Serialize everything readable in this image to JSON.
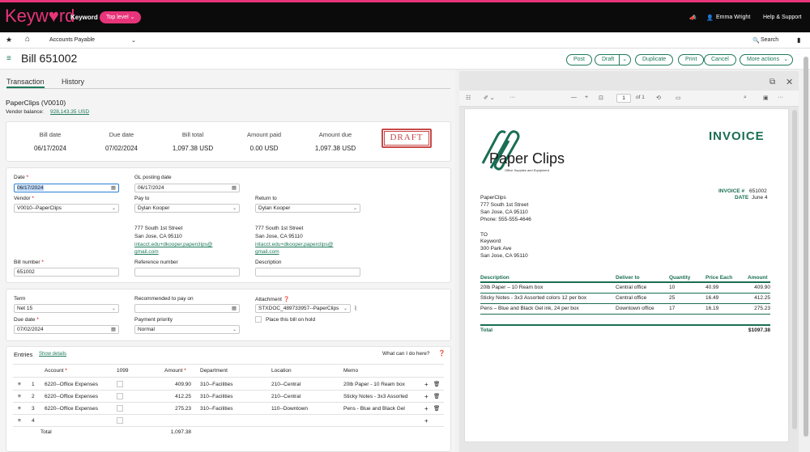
{
  "app": {
    "logo": "Keyw♥rd",
    "logo_sub": "Keyword",
    "top_level": "Top level",
    "user_name": "Emma Wright",
    "help": "Help & Support"
  },
  "nav": {
    "module": "Accounts Payable",
    "search": "Search"
  },
  "titlebar": {
    "title": "Bill 651002",
    "post": "Post",
    "draft": "Draft",
    "duplicate": "Duplicate",
    "print": "Print",
    "cancel": "Cancel",
    "more": "More actions"
  },
  "tabs": {
    "transaction": "Transaction",
    "history": "History"
  },
  "vendor": {
    "name": "PaperClips (V0010)",
    "balance_label": "Vendor balance:",
    "balance": "928,143.35 USD"
  },
  "summary": {
    "bill_date_label": "Bill date",
    "bill_date": "06/17/2024",
    "due_date_label": "Due date",
    "due_date": "07/02/2024",
    "bill_total_label": "Bill total",
    "bill_total": "1,097.38 USD",
    "amount_paid_label": "Amount paid",
    "amount_paid": "0.00 USD",
    "amount_due_label": "Amount due",
    "amount_due": "1,097.38 USD",
    "stamp": "DRAFT"
  },
  "form": {
    "date_label": "Date",
    "date": "06/17/2024",
    "gl_label": "GL posting date",
    "gl": "06/17/2024",
    "vendor_label": "Vendor",
    "vendor": "V0010--PaperClips",
    "payto_label": "Pay to",
    "payto": "Dylan Kooper",
    "returnto_label": "Return to",
    "returnto": "Dylan Kooper",
    "addr1": "777 South 1st Street",
    "addr2": "San Jose, CA 95110",
    "email1": "intacct.edu+dkooper.paperclips@",
    "email2": "gmail.com",
    "billno_label": "Bill number",
    "billno": "651002",
    "ref_label": "Reference number",
    "ref": "",
    "desc_label": "Description",
    "desc": "",
    "term_label": "Term",
    "term": "Net 15",
    "recpay_label": "Recommended to pay on",
    "recpay": "",
    "attach_label": "Attachment",
    "attach": "STXDOC_489733957--PaperClips",
    "due_label": "Due date",
    "due": "07/02/2024",
    "priority_label": "Payment priority",
    "priority": "Normal",
    "hold_label": "Place this bill on hold"
  },
  "entries": {
    "title": "Entries",
    "show_defaults": "Show details",
    "help": "What can I do here?",
    "headers": {
      "account": "Account",
      "c1099": "1099",
      "amount": "Amount",
      "department": "Department",
      "location": "Location",
      "memo": "Memo"
    },
    "rows": [
      {
        "n": "1",
        "account": "6220--Office Expenses",
        "amount": "409.90",
        "department": "310--Facilities",
        "location": "210--Central",
        "memo": "20lb Paper - 10 Ream box"
      },
      {
        "n": "2",
        "account": "6220--Office Expenses",
        "amount": "412.25",
        "department": "310--Facilities",
        "location": "210--Central",
        "memo": "Sticky Notes - 3x3 Assorted"
      },
      {
        "n": "3",
        "account": "6220--Office Expenses",
        "amount": "275.23",
        "department": "310--Facilities",
        "location": "110--Downtown",
        "memo": "Pens - Blue and Black Gel"
      },
      {
        "n": "4",
        "account": "",
        "amount": "",
        "department": "",
        "location": "",
        "memo": ""
      }
    ],
    "total_label": "Total",
    "total": "1,097.38"
  },
  "pdf": {
    "page": "1",
    "of": "of 1",
    "zoom_minus": "—",
    "zoom_plus": "+"
  },
  "invoice": {
    "brand": "Paper Clips",
    "brand_sub": "Office Supplies and Equipment",
    "heading": "INVOICE",
    "invoice_no_label": "INVOICE #",
    "invoice_no": "651002",
    "date_label": "DATE",
    "date": "June 4",
    "from": [
      "PaperClips",
      "777 South 1st Street",
      "San Jose, CA 95110",
      "Phone: 555-555-4646"
    ],
    "to_label": "TO",
    "to": [
      "Keyword",
      "300 Park Ave",
      "San Jose, CA 95110"
    ],
    "headers": {
      "description": "Description",
      "deliver": "Deliver to",
      "quantity": "Quantity",
      "price": "Price Each",
      "amount": "Amount"
    },
    "lines": [
      {
        "description": "20lb Paper – 10 Ream box",
        "deliver": "Central office",
        "quantity": "10",
        "price": "40.99",
        "amount": "409.90"
      },
      {
        "description": "Sticky Notes - 3x3 Assorted colors 12 per box",
        "deliver": "Central office",
        "quantity": "25",
        "price": "16.49",
        "amount": "412.25"
      },
      {
        "description": "Pens – Blue and Black Gel ink, 24 per box",
        "deliver": "Downtown office",
        "quantity": "17",
        "price": "16.19",
        "amount": "275.23"
      }
    ],
    "total_label": "Total",
    "total": "$1097.38"
  },
  "colors": {
    "brand": "#e8347a",
    "accent": "#1e7a5a",
    "invoice_green": "#1a6e54"
  }
}
